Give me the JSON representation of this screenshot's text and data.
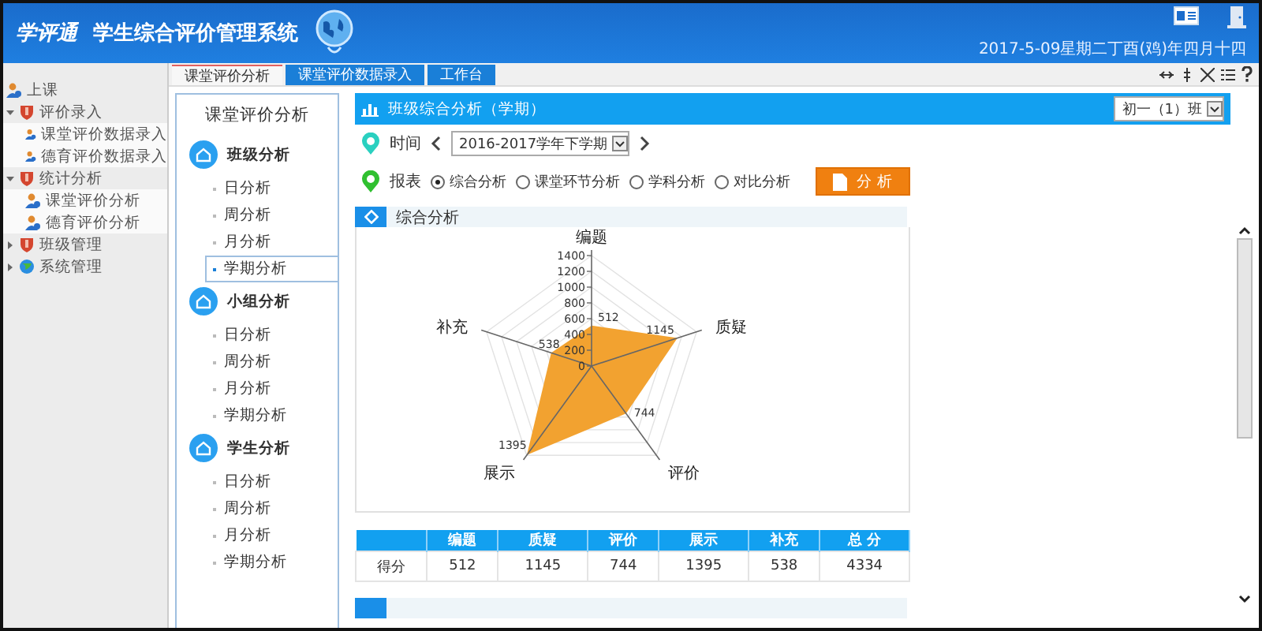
{
  "header": {
    "title": "学生综合评价管理系统",
    "logo_text": "学评通",
    "date": "2017-5-09星期二丁酉(鸡)年四月十四"
  },
  "sidebar": {
    "items": [
      {
        "label": "上课"
      },
      {
        "label": "评价录入",
        "expanded": true,
        "children": [
          {
            "label": "课堂评价数据录入"
          },
          {
            "label": "德育评价数据录入"
          }
        ]
      },
      {
        "label": "统计分析",
        "expanded": true,
        "children": [
          {
            "label": "课堂评价分析"
          },
          {
            "label": "德育评价分析"
          }
        ]
      },
      {
        "label": "班级管理",
        "expanded": false
      },
      {
        "label": "系统管理",
        "expanded": false
      }
    ]
  },
  "tabs": [
    {
      "label": "课堂评价分析",
      "selected": true
    },
    {
      "label": "课堂评价数据录入",
      "selected": false
    },
    {
      "label": "工作台",
      "selected": false
    }
  ],
  "nav": {
    "title": "课堂评价分析",
    "sections": [
      {
        "label": "班级分析",
        "items": [
          {
            "label": "日分析",
            "selected": false
          },
          {
            "label": "周分析",
            "selected": false
          },
          {
            "label": "月分析",
            "selected": false
          },
          {
            "label": "学期分析",
            "selected": true
          }
        ]
      },
      {
        "label": "小组分析",
        "items": [
          {
            "label": "日分析",
            "selected": false
          },
          {
            "label": "周分析",
            "selected": false
          },
          {
            "label": "月分析",
            "selected": false
          },
          {
            "label": "学期分析",
            "selected": false
          }
        ]
      },
      {
        "label": "学生分析",
        "items": [
          {
            "label": "日分析",
            "selected": false
          },
          {
            "label": "周分析",
            "selected": false
          },
          {
            "label": "月分析",
            "selected": false
          },
          {
            "label": "学期分析",
            "selected": false
          }
        ]
      }
    ]
  },
  "panel": {
    "title": "班级综合分析（学期）",
    "class_select": "初一（1）班",
    "time_label": "时间",
    "term_select": "2016-2017学年下学期",
    "report_label": "报表",
    "reports": [
      {
        "label": "综合分析",
        "selected": true
      },
      {
        "label": "课堂环节分析",
        "selected": false
      },
      {
        "label": "学科分析",
        "selected": false
      },
      {
        "label": "对比分析",
        "selected": false
      }
    ],
    "analyze_button": "分 析",
    "section_title": "综合分析",
    "chart_data": {
      "type": "radar",
      "categories": [
        "编题",
        "质疑",
        "评价",
        "展示",
        "补充"
      ],
      "values": [
        512,
        1145,
        744,
        1395,
        538
      ],
      "ylim": [
        0,
        1400
      ],
      "yticks": [
        0,
        200,
        400,
        600,
        800,
        1000,
        1200,
        1400
      ],
      "data_labels": true
    },
    "table": {
      "columns": [
        "",
        "编题",
        "质疑",
        "评价",
        "展示",
        "补充",
        "总 分"
      ],
      "rows": [
        [
          "得分",
          "512",
          "1145",
          "744",
          "1395",
          "538",
          "4334"
        ]
      ]
    }
  }
}
